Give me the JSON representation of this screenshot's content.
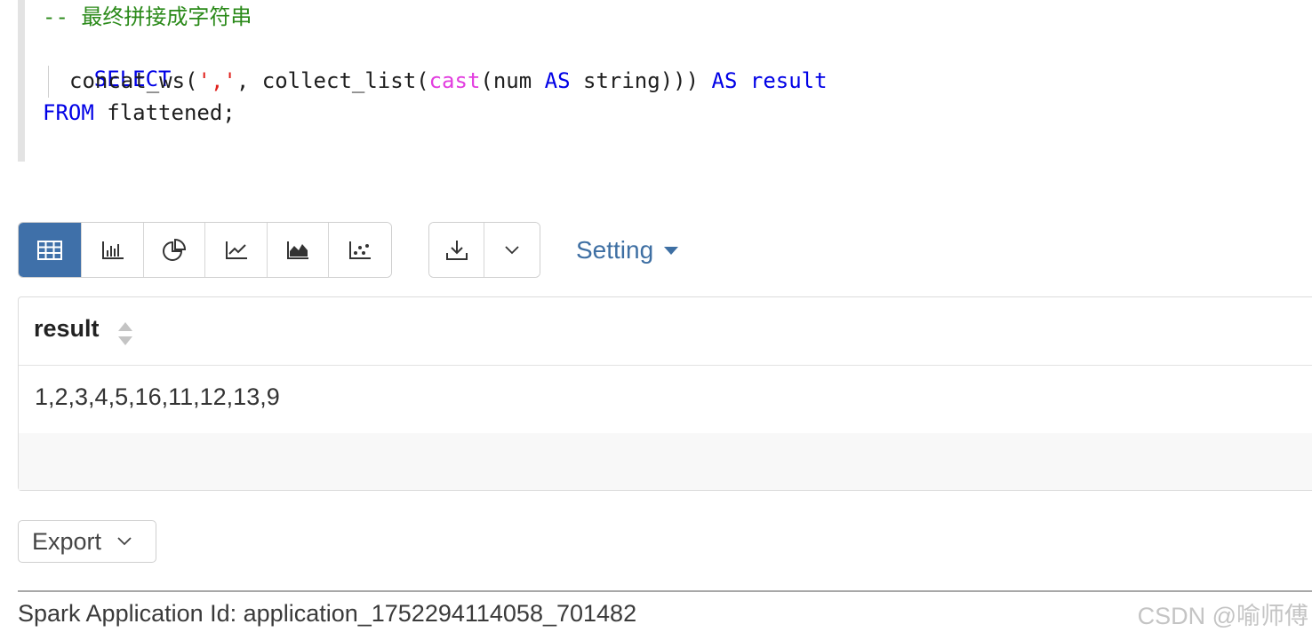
{
  "editor": {
    "comment": "-- 最终拼接成字符串",
    "line2": {
      "kw": "SELECT"
    },
    "line3": {
      "t1": "concat_ws(",
      "str": "','",
      "t2": ", collect_list(",
      "fn": "cast",
      "t3": "(num ",
      "kw1": "AS",
      "t4": " string))) ",
      "kw2": "AS",
      "t5": " ",
      "kw3": "result"
    },
    "line4": {
      "kw": "FROM",
      "rest": " flattened;"
    }
  },
  "toolbar": {
    "views": [
      {
        "icon": "table-icon",
        "active": true
      },
      {
        "icon": "bar-chart-icon",
        "active": false
      },
      {
        "icon": "pie-chart-icon",
        "active": false
      },
      {
        "icon": "line-chart-icon",
        "active": false
      },
      {
        "icon": "area-chart-icon",
        "active": false
      },
      {
        "icon": "scatter-chart-icon",
        "active": false
      }
    ],
    "download_icon": "download-icon",
    "dropdown_icon": "chevron-down-icon",
    "setting_label": "Setting"
  },
  "table": {
    "columns": [
      "result"
    ],
    "rows": [
      [
        "1,2,3,4,5,16,11,12,13,9"
      ]
    ]
  },
  "export_label": "Export",
  "footer": {
    "app_id": "Spark Application Id: application_1752294114058_701482",
    "watermark": "CSDN @喻师傅"
  },
  "colors": {
    "accent": "#3f70a9",
    "keyword": "#0000e6",
    "comment": "#2b8a1a",
    "string": "#e0201c",
    "function": "#e23ddf"
  }
}
